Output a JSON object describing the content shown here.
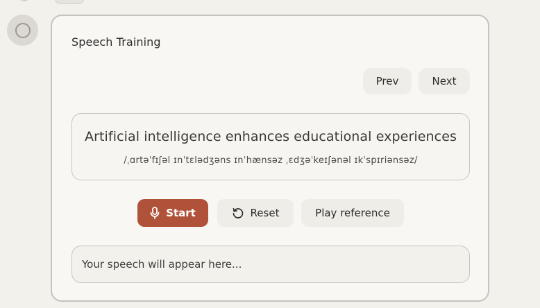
{
  "card": {
    "title": "Speech Training"
  },
  "nav": {
    "prev_label": "Prev",
    "next_label": "Next"
  },
  "sentence": {
    "text": "Artificial intelligence enhances educational experiences",
    "ipa": "/ˌɑrtəˈfɪʃəl ɪnˈtɛlədʒəns ɪnˈhænsəz ˌɛdʒəˈkeɪʃənəl ɪkˈspɪriənsəz/"
  },
  "actions": {
    "start_label": "Start",
    "reset_label": "Reset",
    "play_label": "Play reference"
  },
  "transcript": {
    "placeholder": "Your speech will appear here..."
  },
  "icons": {
    "start": "microphone-icon",
    "reset": "reset-icon",
    "avatar": "avatar-circle-icon"
  },
  "colors": {
    "accent": "#b05239",
    "background": "#f3f1ec",
    "card": "#f8f7f4"
  }
}
